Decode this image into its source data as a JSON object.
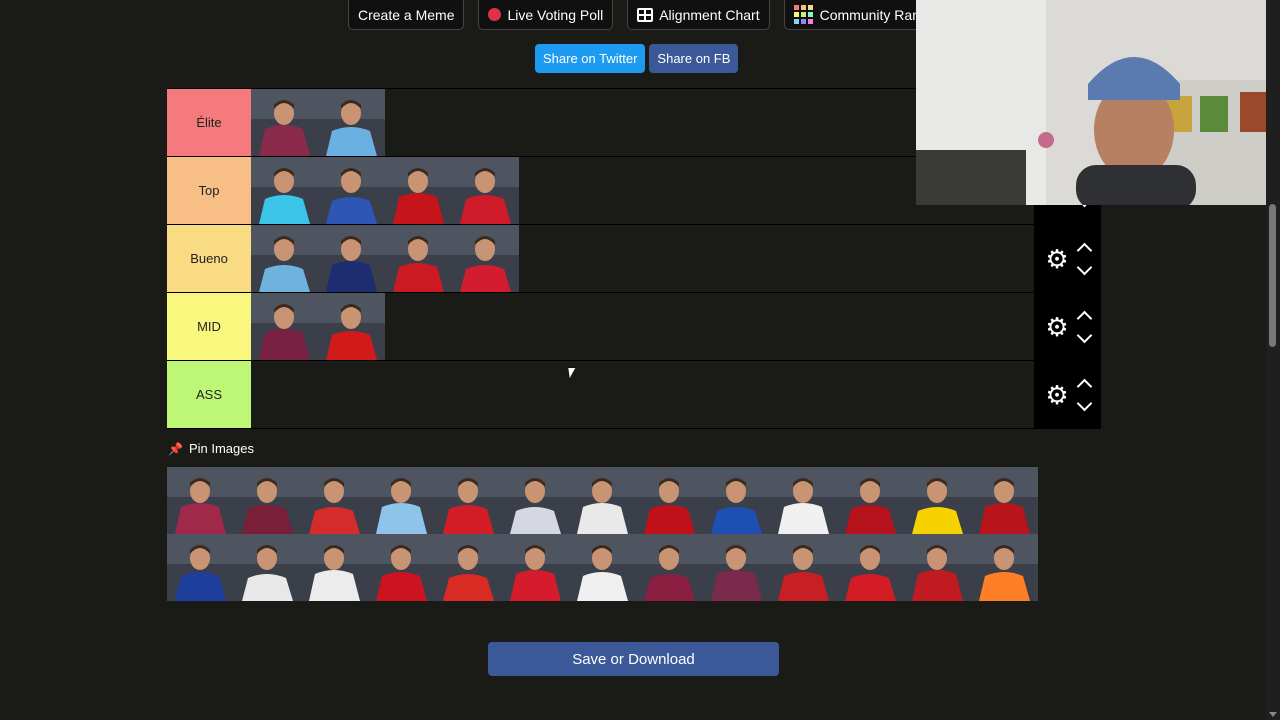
{
  "nav": {
    "meme_label": "Create a Meme",
    "poll_label": "Live Voting Poll",
    "alignment_label": "Alignment Chart",
    "rank_label": "Community Rank"
  },
  "share": {
    "twitter_label": "Share on Twitter",
    "fb_label": "Share on FB"
  },
  "tiers": [
    {
      "label": "Élite",
      "color": "#f47a7d",
      "players": [
        "#8a2a4a",
        "#6ab0e0"
      ]
    },
    {
      "label": "Top",
      "color": "#f7bf86",
      "players": [
        "#3cc3e8",
        "#2d56b5",
        "#c5141a",
        "#cf1a2a"
      ]
    },
    {
      "label": "Bueno",
      "color": "#f9db84",
      "players": [
        "#6eb3de",
        "#1d2d70",
        "#cc1a22",
        "#d31c2f"
      ]
    },
    {
      "label": "MID",
      "color": "#faf77e",
      "players": [
        "#7a2040",
        "#d11a1a"
      ]
    },
    {
      "label": "ASS",
      "color": "#bef775",
      "players": []
    }
  ],
  "pool": {
    "label": "Pin Images",
    "players": [
      "#a02848",
      "#7a1f3a",
      "#d62b2b",
      "#8fc4ea",
      "#d21d26",
      "#d5d8e0",
      "#e9e9e9",
      "#c0111b",
      "#1e4fb5",
      "#f0f0f0",
      "#b5121b",
      "#f7d100",
      "#b8141b",
      "#1e3f9c",
      "#e8e8e8",
      "#ececec",
      "#cc1420",
      "#d92a24",
      "#d51c2c",
      "#f0f0f0",
      "#8a1f42",
      "#7a2a4a",
      "#c71f24",
      "#d41c24",
      "#c01b20",
      "#ff7f27"
    ]
  },
  "save_label": "Save or Download",
  "icons": {
    "settings": "gear-icon",
    "up": "chevron-up-icon",
    "down": "chevron-down-icon",
    "pin": "pushpin-icon"
  }
}
